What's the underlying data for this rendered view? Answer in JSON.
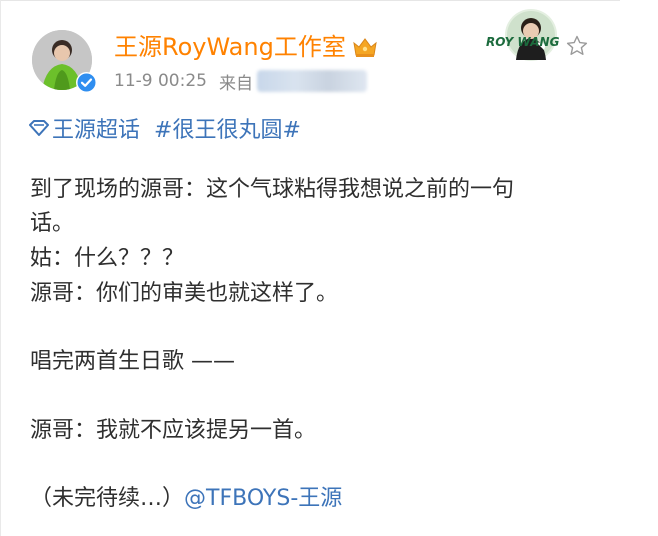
{
  "post": {
    "author": "王源RoyWang工作室",
    "time": "11-9 00:25",
    "source_prefix": "来自",
    "fan_card_text": "ROY WANG",
    "tags": [
      {
        "icon": "super-topic-diamond-icon",
        "label": "王源超话"
      },
      {
        "icon": "",
        "label": "#很王很丸圆#"
      }
    ],
    "lines": [
      "到了现场的源哥：这个气球粘得我想说之前的一句",
      "话。",
      "姑：什么？？？",
      "源哥：你们的审美也就这样了。",
      "唱完两首生日歌 ——",
      "源哥：我就不应该提另一首。",
      "（未完待续…）"
    ],
    "mention": "@TFBOYS-王源"
  },
  "colors": {
    "author": "#ff8200",
    "link": "#3d74b9",
    "meta": "#8a8a8a",
    "text": "#2f2f2f"
  }
}
